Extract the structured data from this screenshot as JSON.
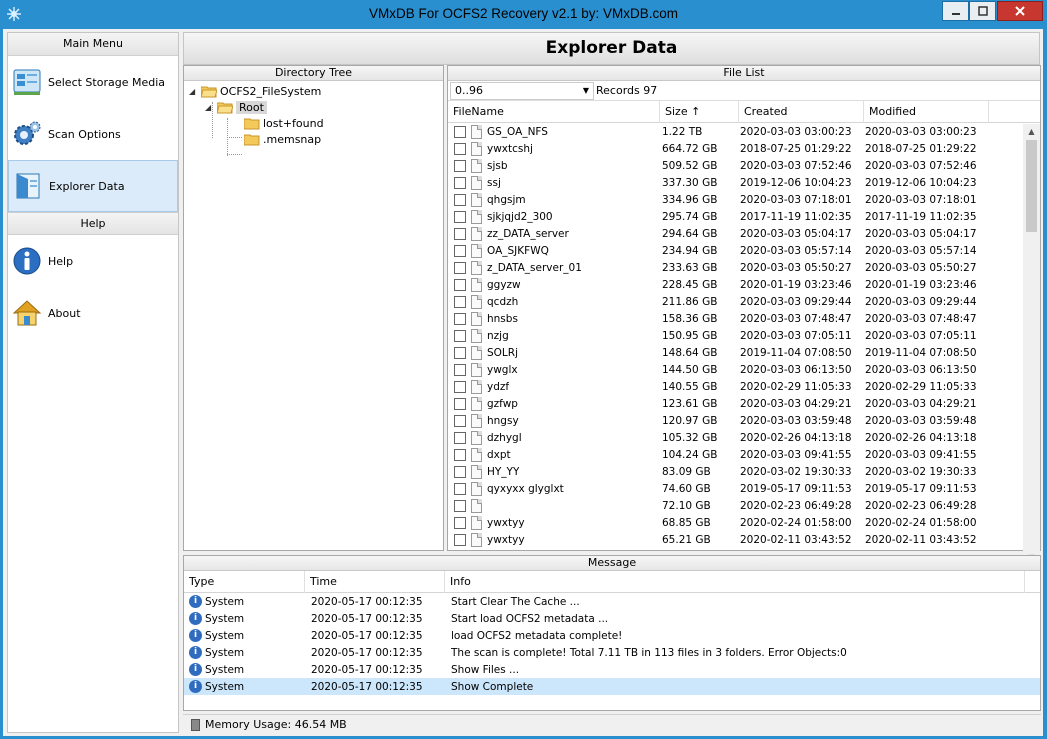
{
  "window": {
    "title": "VMxDB For OCFS2 Recovery v2.1 by: VMxDB.com"
  },
  "sidebar": {
    "main_menu_label": "Main Menu",
    "help_label": "Help",
    "items": [
      {
        "label": "Select Storage Media",
        "icon": "storage-media-icon"
      },
      {
        "label": "Scan Options",
        "icon": "gears-icon"
      },
      {
        "label": "Explorer Data",
        "icon": "explorer-icon"
      }
    ],
    "help_items": [
      {
        "label": "Help",
        "icon": "info-icon"
      },
      {
        "label": "About",
        "icon": "home-icon"
      }
    ]
  },
  "page_title": "Explorer Data",
  "directory_tree": {
    "title": "Directory Tree",
    "nodes": [
      {
        "label": "OCFS2_FileSystem"
      },
      {
        "label": "Root"
      },
      {
        "label": "lost+found"
      },
      {
        "label": ".memsnap"
      }
    ]
  },
  "file_list": {
    "title": "File List",
    "range": "0..96",
    "records": "Records 97",
    "columns": [
      "FileName",
      "Size ↑",
      "Created",
      "Modified"
    ],
    "rows": [
      {
        "name": "GS_OA_NFS",
        "size": "1.22 TB",
        "created": "2020-03-03 03:00:23",
        "modified": "2020-03-03 03:00:23"
      },
      {
        "name": "ywxtcshj",
        "size": "664.72 GB",
        "created": "2018-07-25 01:29:22",
        "modified": "2018-07-25 01:29:22"
      },
      {
        "name": "sjsb",
        "size": "509.52 GB",
        "created": "2020-03-03 07:52:46",
        "modified": "2020-03-03 07:52:46"
      },
      {
        "name": "ssj",
        "size": "337.30 GB",
        "created": "2019-12-06 10:04:23",
        "modified": "2019-12-06 10:04:23"
      },
      {
        "name": "qhgsjm",
        "size": "334.96 GB",
        "created": "2020-03-03 07:18:01",
        "modified": "2020-03-03 07:18:01"
      },
      {
        "name": "sjkjqjd2_300",
        "size": "295.74 GB",
        "created": "2017-11-19 11:02:35",
        "modified": "2017-11-19 11:02:35"
      },
      {
        "name": "zz_DATA_server",
        "size": "294.64 GB",
        "created": "2020-03-03 05:04:17",
        "modified": "2020-03-03 05:04:17"
      },
      {
        "name": "OA_SJKFWQ",
        "size": "234.94 GB",
        "created": "2020-03-03 05:57:14",
        "modified": "2020-03-03 05:57:14"
      },
      {
        "name": "z_DATA_server_01",
        "size": "233.63 GB",
        "created": "2020-03-03 05:50:27",
        "modified": "2020-03-03 05:50:27"
      },
      {
        "name": "ggyzw",
        "size": "228.45 GB",
        "created": "2020-01-19 03:23:46",
        "modified": "2020-01-19 03:23:46"
      },
      {
        "name": "qcdzh",
        "size": "211.86 GB",
        "created": "2020-03-03 09:29:44",
        "modified": "2020-03-03 09:29:44"
      },
      {
        "name": "hnsbs",
        "size": "158.36 GB",
        "created": "2020-03-03 07:48:47",
        "modified": "2020-03-03 07:48:47"
      },
      {
        "name": "nzjg",
        "size": "150.95 GB",
        "created": "2020-03-03 07:05:11",
        "modified": "2020-03-03 07:05:11"
      },
      {
        "name": "SOLRj",
        "size": "148.64 GB",
        "created": "2019-11-04 07:08:50",
        "modified": "2019-11-04 07:08:50"
      },
      {
        "name": "ywglx",
        "size": "144.50 GB",
        "created": "2020-03-03 06:13:50",
        "modified": "2020-03-03 06:13:50"
      },
      {
        "name": "ydzf",
        "size": "140.55 GB",
        "created": "2020-02-29 11:05:33",
        "modified": "2020-02-29 11:05:33"
      },
      {
        "name": "gzfwp",
        "size": "123.61 GB",
        "created": "2020-03-03 04:29:21",
        "modified": "2020-03-03 04:29:21"
      },
      {
        "name": "hngsy",
        "size": "120.97 GB",
        "created": "2020-03-03 03:59:48",
        "modified": "2020-03-03 03:59:48"
      },
      {
        "name": "dzhygl",
        "size": "105.32 GB",
        "created": "2020-02-26 04:13:18",
        "modified": "2020-02-26 04:13:18"
      },
      {
        "name": "dxpt",
        "size": "104.24 GB",
        "created": "2020-03-03 09:41:55",
        "modified": "2020-03-03 09:41:55"
      },
      {
        "name": "HY_YY",
        "size": "83.09 GB",
        "created": "2020-03-02 19:30:33",
        "modified": "2020-03-02 19:30:33"
      },
      {
        "name": "qyxyxx glyglxt",
        "size": "74.60 GB",
        "created": "2019-05-17 09:11:53",
        "modified": "2019-05-17 09:11:53"
      },
      {
        "name": "",
        "size": "72.10 GB",
        "created": "2020-02-23 06:49:28",
        "modified": "2020-02-23 06:49:28"
      },
      {
        "name": "ywxtyy",
        "size": "68.85 GB",
        "created": "2020-02-24 01:58:00",
        "modified": "2020-02-24 01:58:00"
      },
      {
        "name": "ywxtyy",
        "size": "65.21 GB",
        "created": "2020-02-11 03:43:52",
        "modified": "2020-02-11 03:43:52"
      }
    ]
  },
  "messages": {
    "title": "Message",
    "columns": [
      "Type",
      "Time",
      "Info"
    ],
    "rows": [
      {
        "type": "System",
        "time": "2020-05-17 00:12:35",
        "info": "Start Clear The Cache ..."
      },
      {
        "type": "System",
        "time": "2020-05-17 00:12:35",
        "info": "Start load OCFS2 metadata ..."
      },
      {
        "type": "System",
        "time": "2020-05-17 00:12:35",
        "info": "load OCFS2 metadata complete!"
      },
      {
        "type": "System",
        "time": "2020-05-17 00:12:35",
        "info": "The scan is complete!  Total 7.11 TB  in 113 files in 3 folders.  Error Objects:0"
      },
      {
        "type": "System",
        "time": "2020-05-17 00:12:35",
        "info": "Show Files ..."
      },
      {
        "type": "System",
        "time": "2020-05-17 00:12:35",
        "info": "Show Complete"
      }
    ]
  },
  "status": {
    "memory": "Memory Usage: 46.54 MB"
  }
}
